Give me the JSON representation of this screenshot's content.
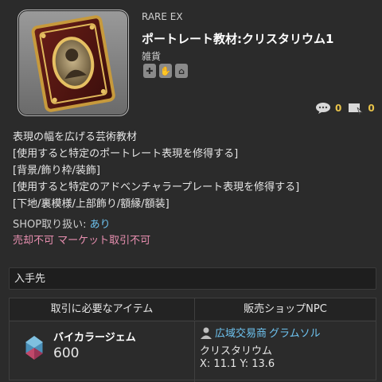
{
  "item": {
    "rarity": "RARE EX",
    "name": "ポートレート教材:クリスタリウム1",
    "category": "雑貨",
    "prop_icons": [
      "cross-icon",
      "hand-icon",
      "house-icon"
    ],
    "comments_count": "0",
    "pins_count": "0"
  },
  "description": [
    "表現の幅を広げる芸術教材",
    "[使用すると特定のポートレート表現を修得する]",
    "[背景/飾り枠/装飾]",
    "[使用すると特定のアドベンチャラープレート表現を修得する]",
    "[下地/裏模様/上部飾り/額縁/額装]"
  ],
  "shop": {
    "label": "SHOP取り扱い: ",
    "value": "あり",
    "restrictions": "売却不可 マーケット取引不可"
  },
  "acquire": {
    "heading": "入手先",
    "col_item": "取引に必要なアイテム",
    "col_shop": "販売ショップNPC",
    "required_item": "バイカラージェム",
    "required_qty": "600",
    "npc_location": "広域交易商",
    "npc_name": "グラムソル",
    "npc_area": "クリスタリウム",
    "npc_coords": "X: 11.1 Y: 13.6"
  },
  "colors": {
    "accent_link": "#6ec3f0",
    "restriction": "#e88fb0",
    "counter": "#e8c34a"
  }
}
